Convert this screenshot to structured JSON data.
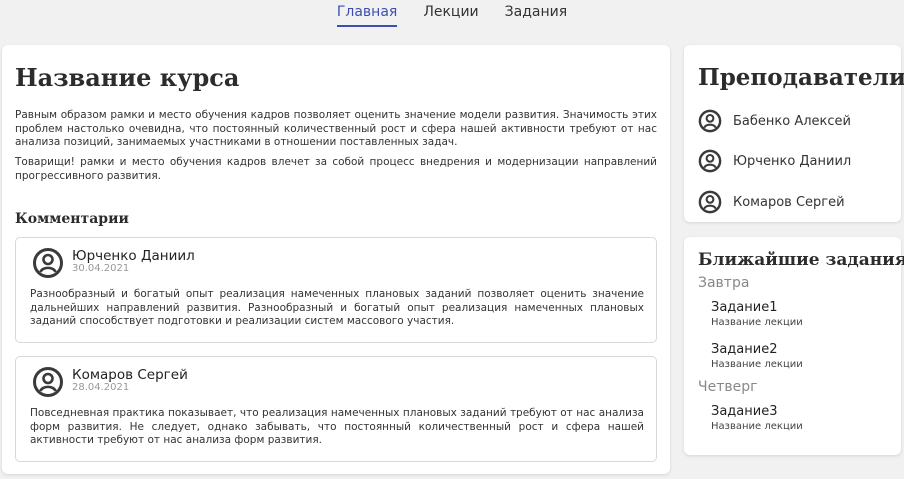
{
  "nav": {
    "items": [
      {
        "label": "Главная",
        "active": true
      },
      {
        "label": "Лекции",
        "active": false
      },
      {
        "label": "Задания",
        "active": false
      }
    ]
  },
  "course": {
    "title": "Название курса",
    "description": [
      "Равным образом рамки и место обучения кадров позволяет оценить значение модели развития. Значимость этих проблем настолько очевидна, что постоянный количественный рост и сфера нашей активности требуют от нас анализа позиций, занимаемых участниками в отношении поставленных задач.",
      "Товарищи! рамки и место обучения кадров влечет за собой процесс внедрения и модернизации направлений прогрессивного развития."
    ]
  },
  "comments": {
    "title": "Комментарии",
    "items": [
      {
        "author": "Юрченко Даниил",
        "date": "30.04.2021",
        "text": "Разнообразный и богатый опыт реализация намеченных плановых заданий позволяет оценить значение дальнейших направлений развития. Разнообразный и богатый опыт реализация намеченных плановых заданий способствует подготовки и реализации систем массового участия.",
        "icon": "user-circle-icon"
      },
      {
        "author": "Комаров Сергей",
        "date": "28.04.2021",
        "text": "Повседневная практика показывает, что реализация намеченных плановых заданий требуют от нас анализа форм развития. Не следует, однако забывать, что постоянный количественный рост и сфера нашей активности требуют от нас анализа форм развития.",
        "icon": "user-circle-icon"
      }
    ]
  },
  "teachers": {
    "title": "Преподаватели",
    "items": [
      {
        "name": "Бабенко Алексей",
        "icon": "user-circle-icon"
      },
      {
        "name": "Юрченко Даниил",
        "icon": "user-circle-icon"
      },
      {
        "name": "Комаров Сергей",
        "icon": "user-circle-icon"
      }
    ]
  },
  "upcoming": {
    "title": "Ближайшие задания",
    "groups": [
      {
        "day": "Завтра",
        "tasks": [
          {
            "name": "Задание1",
            "lecture": "Название лекции"
          },
          {
            "name": "Задание2",
            "lecture": "Название лекции"
          }
        ]
      },
      {
        "day": "Четверг",
        "tasks": [
          {
            "name": "Задание3",
            "lecture": "Название лекции"
          }
        ]
      }
    ]
  },
  "colors": {
    "accent": "#3c4fb0",
    "background": "#f1f1f1",
    "card": "#ffffff",
    "icon": "#3a3a3a"
  }
}
